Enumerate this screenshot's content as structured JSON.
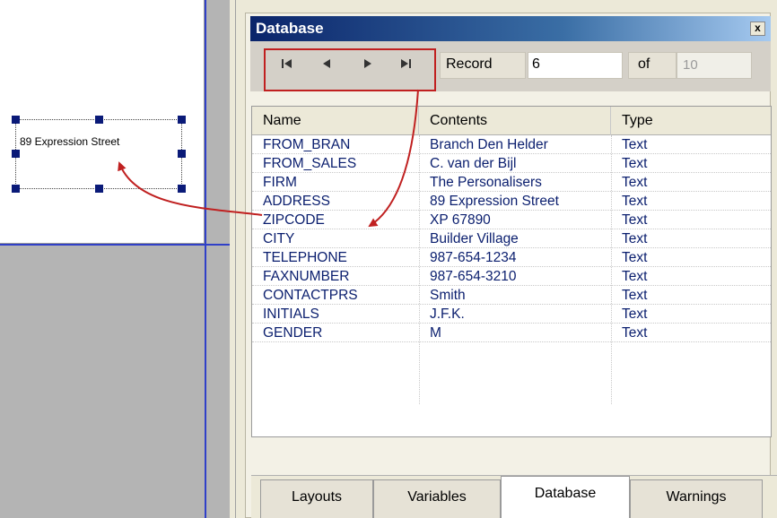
{
  "canvas": {
    "text_object_value": "89 Expression Street"
  },
  "database_window": {
    "title": "Database",
    "close_glyph": "x",
    "nav_buttons": [
      "first-record-icon",
      "previous-record-icon",
      "next-record-icon",
      "last-record-icon"
    ],
    "record_label": "Record",
    "record_value": "6",
    "of_label": "of",
    "total_records": "10"
  },
  "grid": {
    "columns": [
      "Name",
      "Contents",
      "Type"
    ],
    "rows": [
      {
        "name": "FROM_BRAN",
        "contents": "Branch Den Helder",
        "type": "Text"
      },
      {
        "name": "FROM_SALES",
        "contents": "C. van der Bijl",
        "type": "Text"
      },
      {
        "name": "FIRM",
        "contents": "The Personalisers",
        "type": "Text"
      },
      {
        "name": "ADDRESS",
        "contents": "89 Expression Street",
        "type": "Text"
      },
      {
        "name": "ZIPCODE",
        "contents": "XP 67890",
        "type": "Text"
      },
      {
        "name": "CITY",
        "contents": "Builder Village",
        "type": "Text"
      },
      {
        "name": "TELEPHONE",
        "contents": "987-654-1234",
        "type": "Text"
      },
      {
        "name": "FAXNUMBER",
        "contents": "987-654-3210",
        "type": "Text"
      },
      {
        "name": "CONTACTPRS",
        "contents": "Smith",
        "type": "Text"
      },
      {
        "name": "INITIALS",
        "contents": "J.F.K.",
        "type": "Text"
      },
      {
        "name": "GENDER",
        "contents": "M",
        "type": "Text"
      }
    ]
  },
  "tabs": [
    "Layouts",
    "Variables",
    "Database",
    "Warnings"
  ],
  "active_tab": "Database",
  "colors": {
    "title_bar": "#0a246a",
    "guide_line": "#3040c8",
    "annotation": "#c02020",
    "cell_text": "#0a1e6e"
  }
}
